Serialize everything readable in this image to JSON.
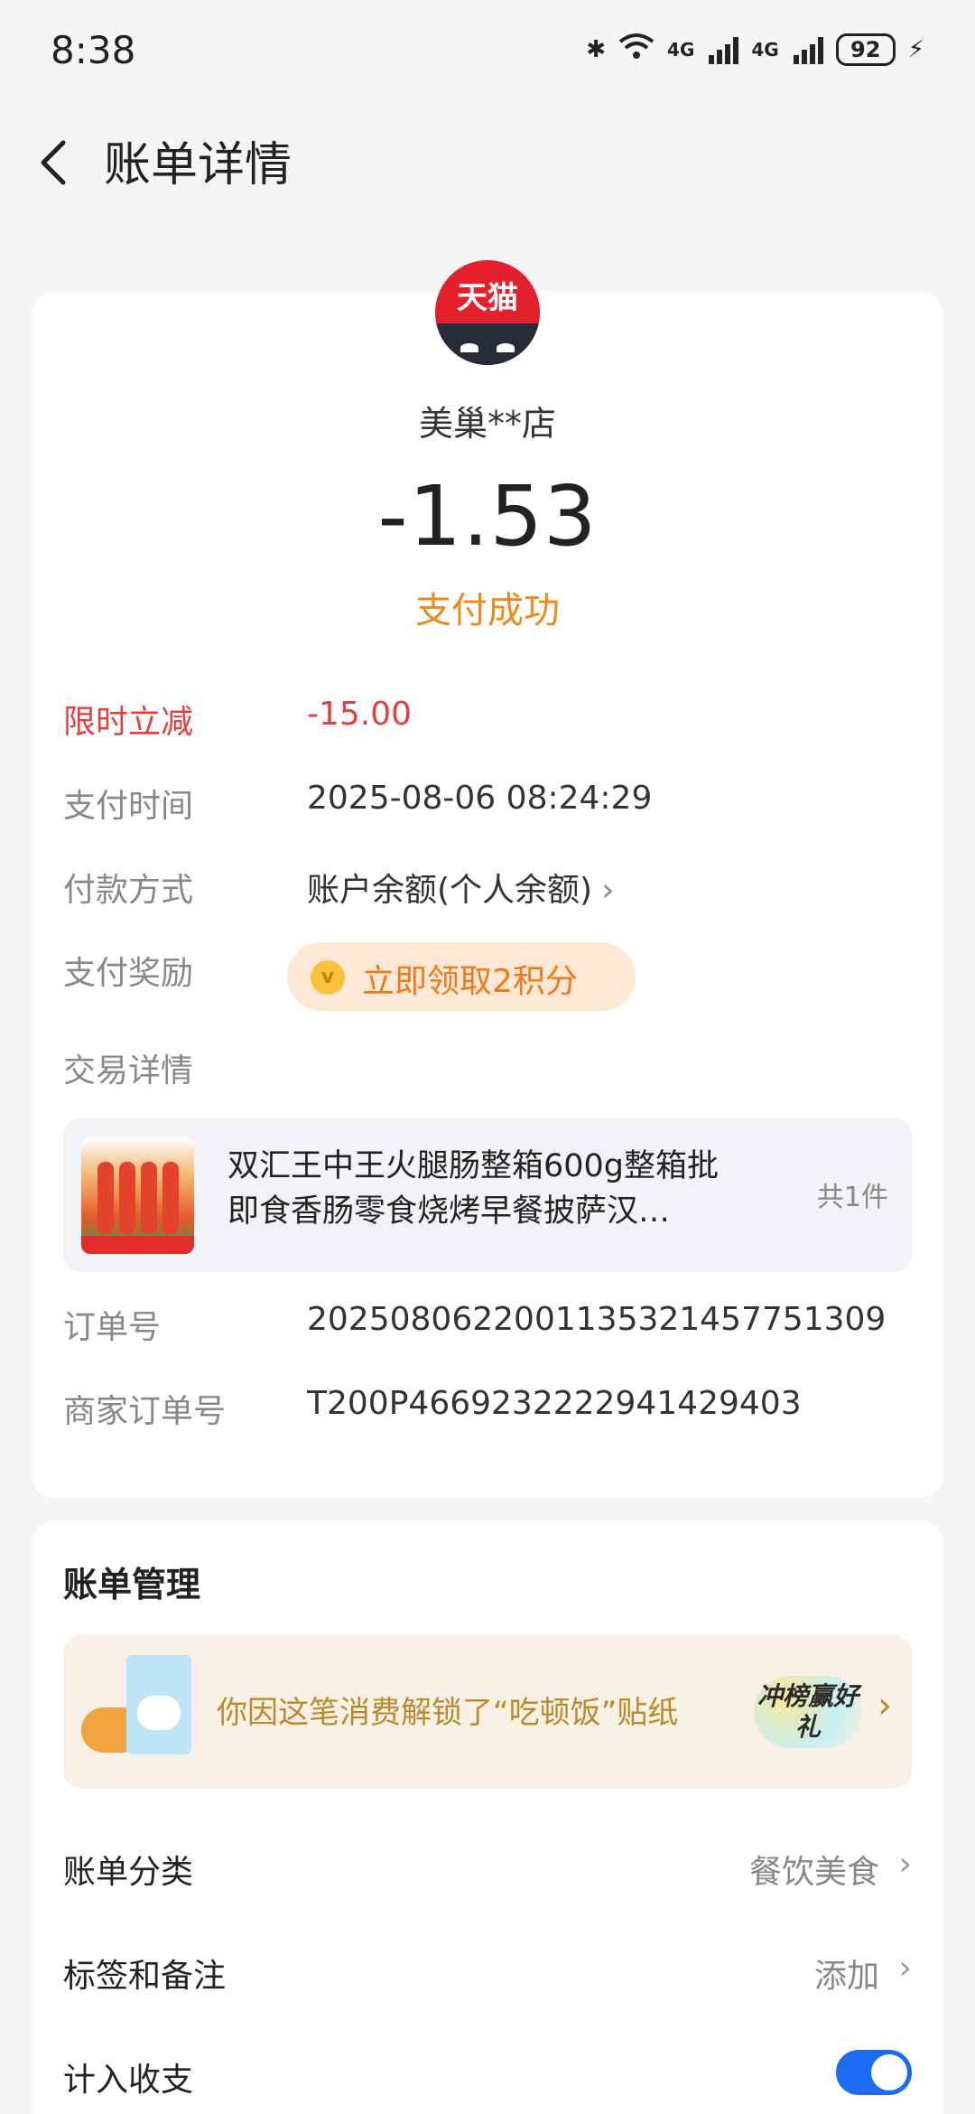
{
  "status_bar": {
    "time": "8:38",
    "network_1": "4G",
    "network_2": "4G",
    "battery": "92"
  },
  "header": {
    "title": "账单详情"
  },
  "bill": {
    "logo_text": "天猫",
    "merchant": "美巢**店",
    "amount": "-1.53",
    "status": "支付成功",
    "status_color": "#f08a16",
    "details": [
      {
        "label": "限时立减",
        "value": "-15.00"
      },
      {
        "label": "支付时间",
        "value": "2025-08-06 08:24:29"
      },
      {
        "label": "付款方式",
        "value": "账户余额(个人余额)"
      },
      {
        "label": "支付奖励",
        "value": "立即领取2积分"
      },
      {
        "label": "交易详情"
      }
    ],
    "product": {
      "name": "双汇王中王火腿肠整箱600g整箱批即食香肠零食烧烤早餐披萨汉…",
      "count": "共1件"
    },
    "order": [
      {
        "label": "订单号",
        "value": "2025080622001135321457751309"
      },
      {
        "label": "商家订单号",
        "value": "T200P4669232222941429403"
      }
    ]
  },
  "management": {
    "title": "账单管理",
    "sticker_text": "你因这笔消费解锁了“吃顿饭”贴纸",
    "rank_badge": "冲榜赢好礼",
    "rows": [
      {
        "label": "账单分类",
        "value": "餐饮美食"
      },
      {
        "label": "标签和备注",
        "value": "添加"
      },
      {
        "label": "计入收支",
        "toggle_on": true
      }
    ]
  },
  "colors": {
    "accent": "#1b6cf2",
    "discount": "#e2413f",
    "brand": "#e3202b"
  }
}
